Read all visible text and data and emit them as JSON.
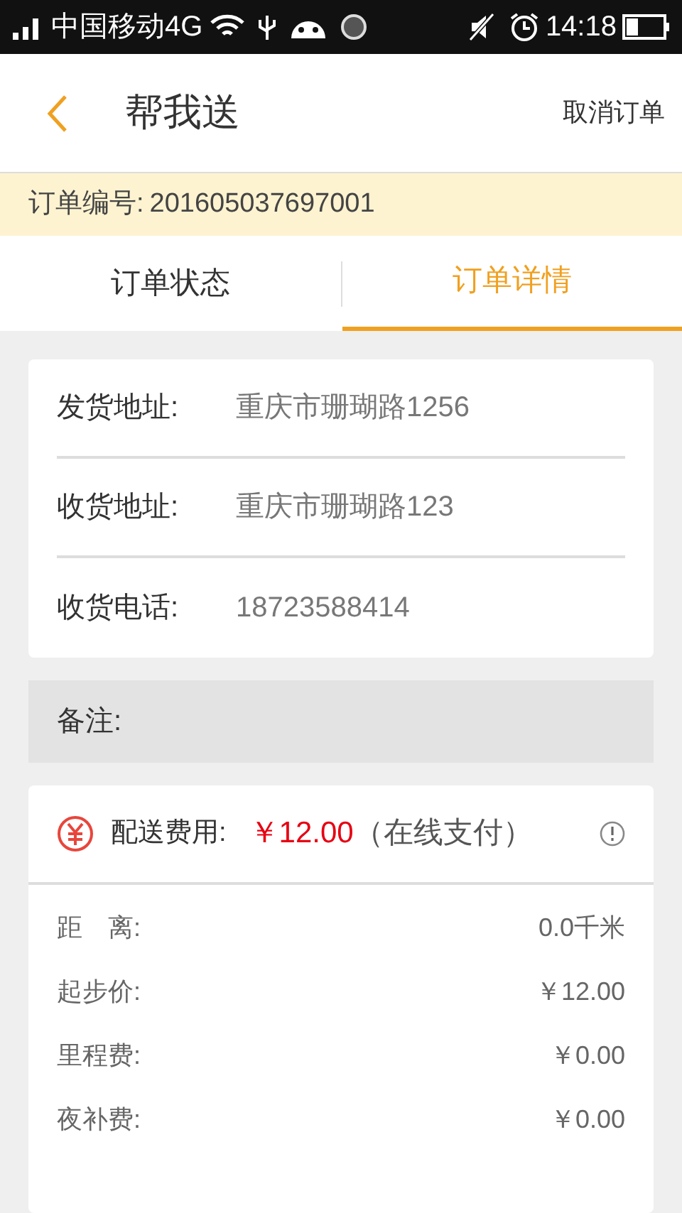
{
  "status_bar": {
    "carrier": "中国移动4G",
    "time": "14:18"
  },
  "header": {
    "title": "帮我送",
    "action": "取消订单"
  },
  "order_number": {
    "label": "订单编号:",
    "value": "201605037697001"
  },
  "tabs": [
    {
      "label": "订单状态",
      "selected": false
    },
    {
      "label": "订单详情",
      "selected": true
    }
  ],
  "addresses": [
    {
      "label": "发货地址:",
      "value": "重庆市珊瑚路1256"
    },
    {
      "label": "收货地址:",
      "value": "重庆市珊瑚路123"
    },
    {
      "label": "收货电话:",
      "value": "18723588414"
    }
  ],
  "remark": {
    "label": "备注:"
  },
  "fee": {
    "label": "配送费用:",
    "amount": "￥12.00",
    "note": "（在线支付）",
    "items": [
      {
        "label": "距　离:",
        "value": "0.0千米"
      },
      {
        "label": "起步价:",
        "value": "￥12.00"
      },
      {
        "label": "里程费:",
        "value": "￥0.00"
      },
      {
        "label": "夜补费:",
        "value": "￥0.00"
      }
    ]
  }
}
